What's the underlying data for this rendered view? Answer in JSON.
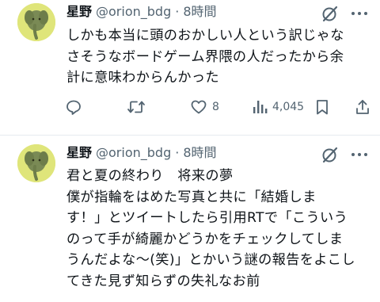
{
  "tweets": [
    {
      "author_name": "星野",
      "handle": "@orion_bdg",
      "separator": "·",
      "time": "8時間",
      "lines": [
        "しかも本当に頭のおかしい人という訳じゃな",
        "さそうなボードゲーム界隈の人だったから余",
        "計に意味わからんかった"
      ],
      "actions": {
        "reply_count": "",
        "retweet_count": "",
        "like_count": "8",
        "view_count": "4,045"
      }
    },
    {
      "author_name": "星野",
      "handle": "@orion_bdg",
      "separator": "·",
      "time": "8時間",
      "lines": [
        "君と夏の終わり　将来の夢",
        "僕が指輪をはめた写真と共に「結婚しま",
        "す！」とツイートしたら引用RTで「こういう",
        "のって手が綺麗かどうかをチェックしてしま",
        "うんだよな〜(笑)」とかいう謎の報告をよこし",
        "てきた見ず知らずの失礼なお前"
      ]
    }
  ],
  "colors": {
    "text_primary": "#0f1419",
    "text_secondary": "#536471",
    "divider": "#e6ebef",
    "avatar_bg": "#dfe57a"
  },
  "icons": {
    "grok": "grok-icon",
    "more": "more-icon",
    "reply": "reply-icon",
    "retweet": "retweet-icon",
    "like": "heart-icon",
    "views": "views-icon",
    "bookmark": "bookmark-icon",
    "share": "share-icon"
  }
}
